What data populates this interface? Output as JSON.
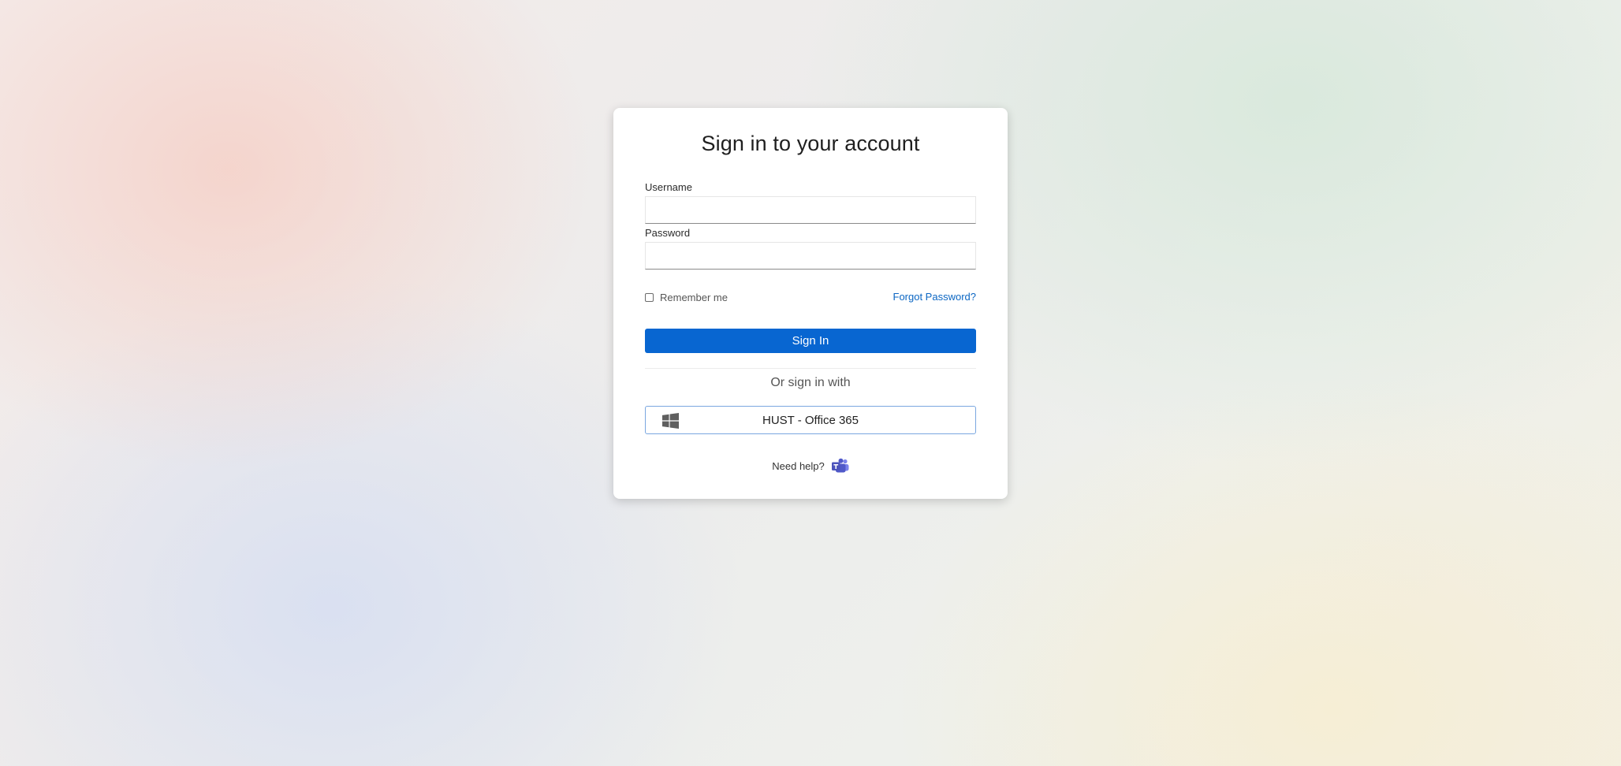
{
  "login": {
    "title": "Sign in to your account",
    "username_label": "Username",
    "username_value": "",
    "password_label": "Password",
    "password_value": "",
    "remember_label": "Remember me",
    "remember_checked": false,
    "forgot_label": "Forgot Password?",
    "signin_label": "Sign In",
    "or_label": "Or sign in with",
    "provider": {
      "label": "HUST - Office 365",
      "icon": "windows-icon"
    },
    "help_label": "Need help?",
    "help_icon": "teams-icon"
  },
  "colors": {
    "accent": "#0866d1",
    "link": "#0b66c3",
    "teams": "#5059c9"
  }
}
